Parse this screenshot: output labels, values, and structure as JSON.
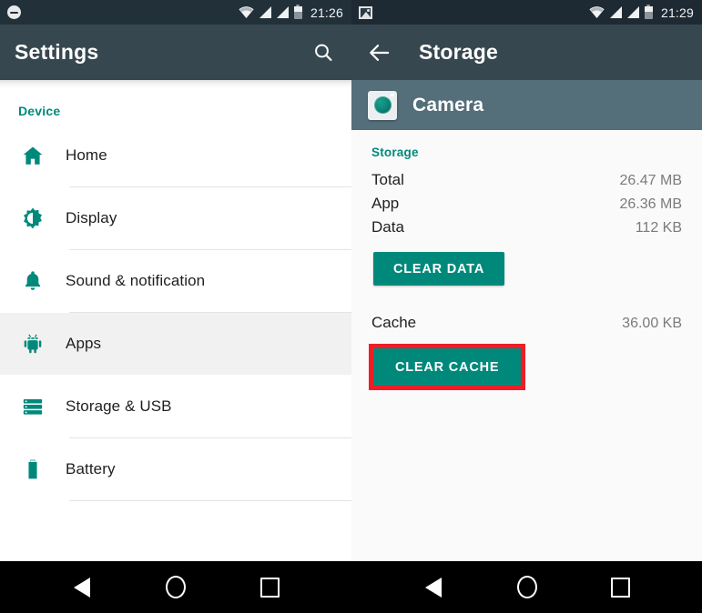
{
  "left_screen": {
    "status_bar": {
      "time": "21:26",
      "icons": [
        "do-not-disturb-icon",
        "wifi-icon",
        "signal-icon",
        "signal-icon",
        "battery-icon"
      ]
    },
    "app_bar": {
      "title": "Settings",
      "search_icon": "search-icon"
    },
    "section_header": "Device",
    "items": [
      {
        "label": "Home",
        "icon": "home-icon",
        "selected": false
      },
      {
        "label": "Display",
        "icon": "brightness-icon",
        "selected": false
      },
      {
        "label": "Sound & notification",
        "icon": "bell-icon",
        "selected": false
      },
      {
        "label": "Apps",
        "icon": "android-icon",
        "selected": true
      },
      {
        "label": "Storage & USB",
        "icon": "storage-icon",
        "selected": false
      },
      {
        "label": "Battery",
        "icon": "battery-icon",
        "selected": false
      }
    ],
    "nav_bar": {
      "back": "back-triangle-icon",
      "home": "home-circle-icon",
      "recents": "recents-square-icon"
    }
  },
  "right_screen": {
    "status_bar": {
      "time": "21:29",
      "icons": [
        "screenshot-icon",
        "wifi-icon",
        "signal-icon",
        "signal-icon",
        "battery-icon"
      ]
    },
    "app_bar": {
      "title": "Storage",
      "back_icon": "arrow-back-icon"
    },
    "app_row": {
      "name": "Camera",
      "icon": "camera-app-icon"
    },
    "storage_section": {
      "title": "Storage",
      "rows": [
        {
          "key": "Total",
          "value": "26.47 MB"
        },
        {
          "key": "App",
          "value": "26.36 MB"
        },
        {
          "key": "Data",
          "value": "112 KB"
        }
      ],
      "clear_data_label": "CLEAR DATA"
    },
    "cache_section": {
      "key": "Cache",
      "value": "36.00 KB",
      "clear_cache_label": "CLEAR CACHE",
      "highlighted": true
    },
    "nav_bar": {
      "back": "back-triangle-icon",
      "home": "home-circle-icon",
      "recents": "recents-square-icon"
    }
  },
  "colors": {
    "accent_teal": "#00897b",
    "app_bar_dark": "#37474f",
    "app_row_slate": "#546e7a",
    "status_bar": "#22303a",
    "highlight_red": "#ee1d26",
    "selected_row": "#f1f1f1",
    "detail_bg": "#fafafa"
  }
}
